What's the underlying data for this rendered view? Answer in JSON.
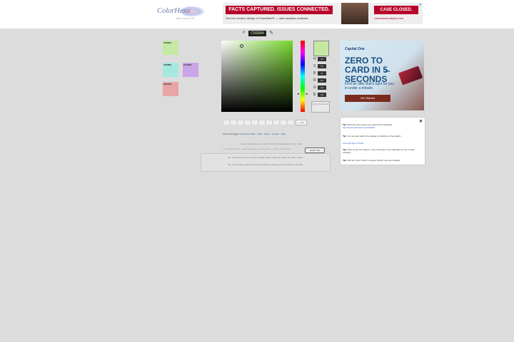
{
  "header": {
    "logo_text": "ColorHexa",
    "logo_sub": "web color tools",
    "banner": {
      "headline": "FACTS CAPTURED. ISSUES CONNECTED.",
      "subline": "See the modern design of CaseWare® — data analytics software.",
      "right_headline": "CASE CLOSED.",
      "right_subline": "casewareanalytics.com",
      "close_glyph": "✕"
    }
  },
  "picker": {
    "hex_label": "#",
    "hex_value": "C5E8A4",
    "eyedropper": "✎",
    "fields": [
      {
        "label": "H",
        "value": "90"
      },
      {
        "label": "S",
        "value": "56"
      },
      {
        "label": "B",
        "value": "91"
      },
      {
        "label": "R",
        "value": "197"
      },
      {
        "label": "G",
        "value": "232"
      },
      {
        "label": "B",
        "value": "164"
      }
    ],
    "old_preview_label": "Set to the Palette",
    "add_button": "+ add",
    "hue_arrow_left": "▸",
    "hue_arrow_right": "◂"
  },
  "swatches": [
    {
      "label": "C5E8A4",
      "color": "#c5e8a4"
    },
    {
      "label": "A5E8E0",
      "color": "#a5e8e0"
    },
    {
      "label": "C9A5E8",
      "color": "#c9a5e8"
    },
    {
      "label": "E8A5A5",
      "color": "#e8a5a5"
    }
  ],
  "links": {
    "prefix": "Link to this page:",
    "items": [
      "Download HTML",
      "Save",
      "Share",
      "Contact",
      "Help"
    ]
  },
  "credit": "Link to ColorHexa.com: Quick Tips | CSS Examples | Color Chart",
  "copyright": "© ColorHexa.com · Quick Online Color Picker Tool · HTML Color Picker",
  "got_it_button": "Quick Tips",
  "tips_box": [
    "Tip: Click the lock icon to keep a shade stable while you adjust the other values.",
    "Tip: You can also add a color to the palette by clicking on the swatch on the left."
  ],
  "right_ad": {
    "brand": "Capital One",
    "headline": "ZERO TO CARD IN 5̶ SECONDS",
    "sub": "Find an offer that's right for you in under a minute.",
    "cta": "Get Started"
  },
  "tips_panel": {
    "close_glyph": "✕",
    "items": [
      {
        "title": "Tip:",
        "text": "Click the lock to keep one value fixed. Example:",
        "link": "http://www.colorhexa.com/c5e8a4"
      },
      {
        "title": "Tip:",
        "text": "You can also add to the palette by clicking on the swatch.",
        "link": ""
      },
      {
        "title": "",
        "text": "",
        "link": "Show all Tips & Tricks"
      },
      {
        "title": "Tip:",
        "text": "Click on the hex value to copy it directly to the clipboard for use in other software.",
        "link": ""
      },
      {
        "title": "Tip:",
        "text": "Visit the Color Chart to explore further hues and shades.",
        "link": "Color Chart"
      }
    ]
  }
}
